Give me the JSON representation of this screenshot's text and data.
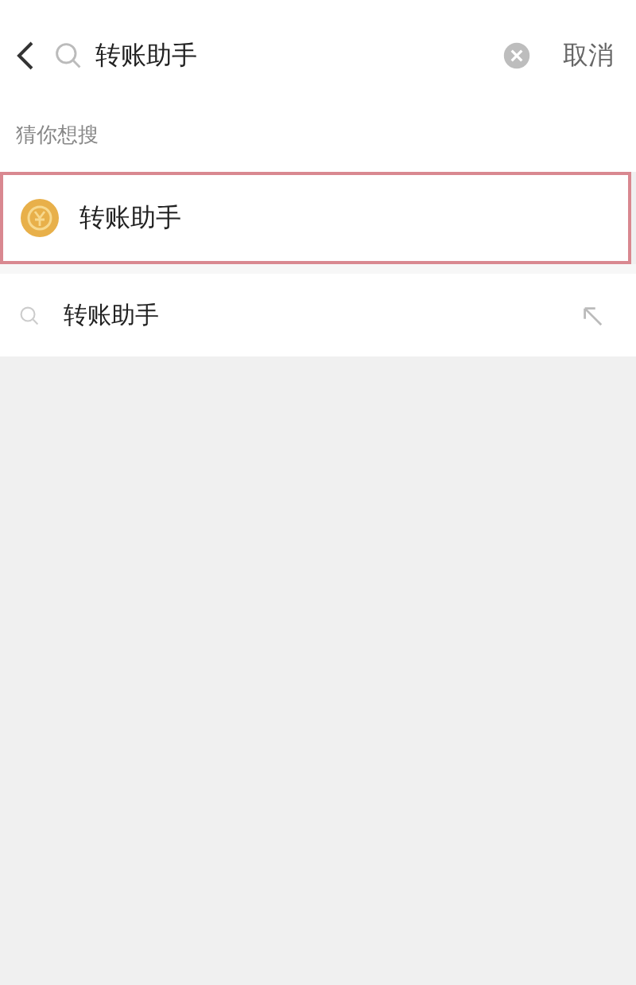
{
  "search": {
    "value": "转账助手",
    "cancel": "取消"
  },
  "suggestions": {
    "title": "猜你想搜",
    "items": [
      {
        "label": "转账助手",
        "selected": true
      }
    ]
  },
  "results": [
    {
      "label": "转账助手"
    }
  ]
}
